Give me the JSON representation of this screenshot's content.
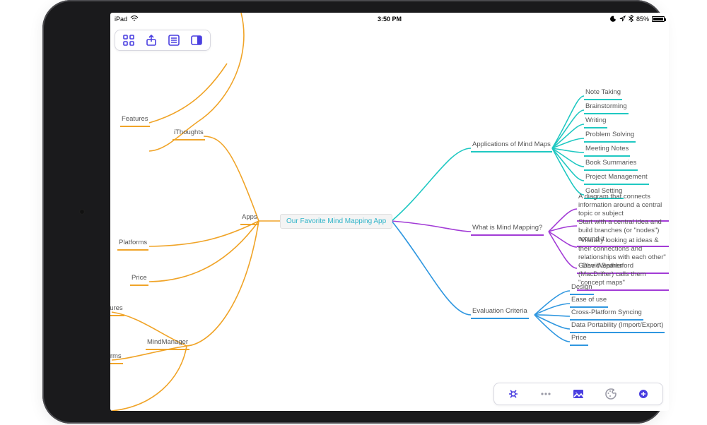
{
  "status": {
    "carrier": "iPad",
    "time": "3:50 PM",
    "battery_pct": "85%"
  },
  "toolbar_top": {
    "grid": "grid-view",
    "share": "share",
    "outline": "outline-list",
    "sidebar": "panel-toggle"
  },
  "toolbar_bottom": {
    "style": "node-style",
    "more": "more-options",
    "image": "insert-image",
    "palette": "color-palette",
    "add": "add-node"
  },
  "center_node": "Our Favorite Mind Mapping App",
  "left": {
    "apps_label": "Apps",
    "ithoughts": "iThoughts",
    "mindmanager": "MindManager",
    "features": "Features",
    "platforms": "Platforms",
    "price": "Price",
    "features2": "eatures",
    "platforms2": "atforms"
  },
  "branches": {
    "applications": {
      "label": "Applications of Mind Maps",
      "items": [
        "Note Taking",
        "Brainstorming",
        "Writing",
        "Problem Solving",
        "Meeting Notes",
        "Book Summaries",
        "Project Management",
        "Goal Setting"
      ]
    },
    "whatis": {
      "label": "What is Mind Mapping?",
      "items": [
        "A diagram that connects information around a central topic or subject",
        "Start with a central idea and build branches (or \"nodes\") around it",
        "\"Visually looking at ideas & their connections and relationships with each other\" - David Sparks",
        "Gabe Weatherford (MacDrifter) calls them \"concept maps\""
      ]
    },
    "criteria": {
      "label": "Evaluation Criteria",
      "items": [
        "Design",
        "Ease of use",
        "Cross-Platform Syncing",
        "Data Portability (Import/Export)",
        "Price"
      ]
    }
  },
  "colors": {
    "teal": "#1fc8c2",
    "purple": "#a23bd6",
    "blue": "#2f97e0",
    "orange": "#f0a428"
  }
}
